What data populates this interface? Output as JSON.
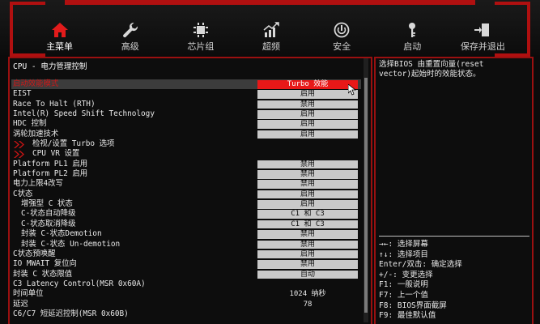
{
  "tabs": [
    {
      "label": "主菜单",
      "icon": "home-icon",
      "active": true
    },
    {
      "label": "高级",
      "icon": "wrench-icon",
      "active": false
    },
    {
      "label": "芯片组",
      "icon": "chip-icon",
      "active": false
    },
    {
      "label": "超频",
      "icon": "overclock-chart-icon",
      "active": false
    },
    {
      "label": "安全",
      "icon": "power-shield-icon",
      "active": false
    },
    {
      "label": "启动",
      "icon": "key-icon",
      "active": false
    },
    {
      "label": "保存并退出",
      "icon": "exit-door-icon",
      "active": false
    }
  ],
  "breadcrumb": "CPU - 电力管理控制",
  "rows": [
    {
      "name": "启动效能模式",
      "value": "Turbo 效能",
      "selected": true
    },
    {
      "name": "EIST",
      "value": "启用"
    },
    {
      "name": "Race To Halt (RTH)",
      "value": "禁用"
    },
    {
      "name": "Intel(R) Speed Shift Technology",
      "value": "启用"
    },
    {
      "name": "HDC 控制",
      "value": "启用"
    },
    {
      "name": "涡轮加速技术",
      "value": "启用"
    },
    {
      "name": "检视/设置 Turbo 选项",
      "value": "",
      "submenu": true
    },
    {
      "name": "CPU VR 设置",
      "value": "",
      "submenu": true
    },
    {
      "name": "Platform PL1 启用",
      "value": "禁用"
    },
    {
      "name": "Platform PL2 启用",
      "value": "禁用"
    },
    {
      "name": "电力上限4改写",
      "value": "禁用"
    },
    {
      "name": "C状态",
      "value": "启用"
    },
    {
      "name": "增强型 C 状态",
      "value": "启用",
      "indent": true
    },
    {
      "name": "C-状态自动降级",
      "value": "C1 和 C3",
      "indent": true
    },
    {
      "name": "C-状态取消降级",
      "value": "C1 和 C3",
      "indent": true
    },
    {
      "name": "封装 C-状态Demotion",
      "value": "禁用",
      "indent": true
    },
    {
      "name": "封装 C-状态 Un-demotion",
      "value": "禁用",
      "indent": true
    },
    {
      "name": "C状态预唤醒",
      "value": "启用"
    },
    {
      "name": "IO MWAIT 复位向",
      "value": "禁用"
    },
    {
      "name": "封装 C 状态限值",
      "value": "自动"
    },
    {
      "name": "C3 Latency Control(MSR 0x60A)",
      "value": "",
      "plain": true
    },
    {
      "name": "时间单位",
      "value": "1024  纳秒",
      "plain": true
    },
    {
      "name": "延迟",
      "value": "78",
      "plain": true
    },
    {
      "name": "C6/C7 短延迟控制(MSR 0x60B)",
      "value": "",
      "plain": true
    }
  ],
  "help_text": "选择BIOS 由重置向量(reset\nvector)起始时的效能状态。",
  "keys": [
    "→←: 选择屏幕",
    "↑↓: 选择项目",
    "Enter/双击: 确定选择",
    "+/-: 变更选择",
    "F1: 一般说明",
    "F7: 上一个值",
    "F8: BIOS界面截屏",
    "F9: 最佳默认值"
  ],
  "colors": {
    "accent": "#e21b1b",
    "frame": "#9a1010",
    "value_bg": "#c9c9c9"
  }
}
